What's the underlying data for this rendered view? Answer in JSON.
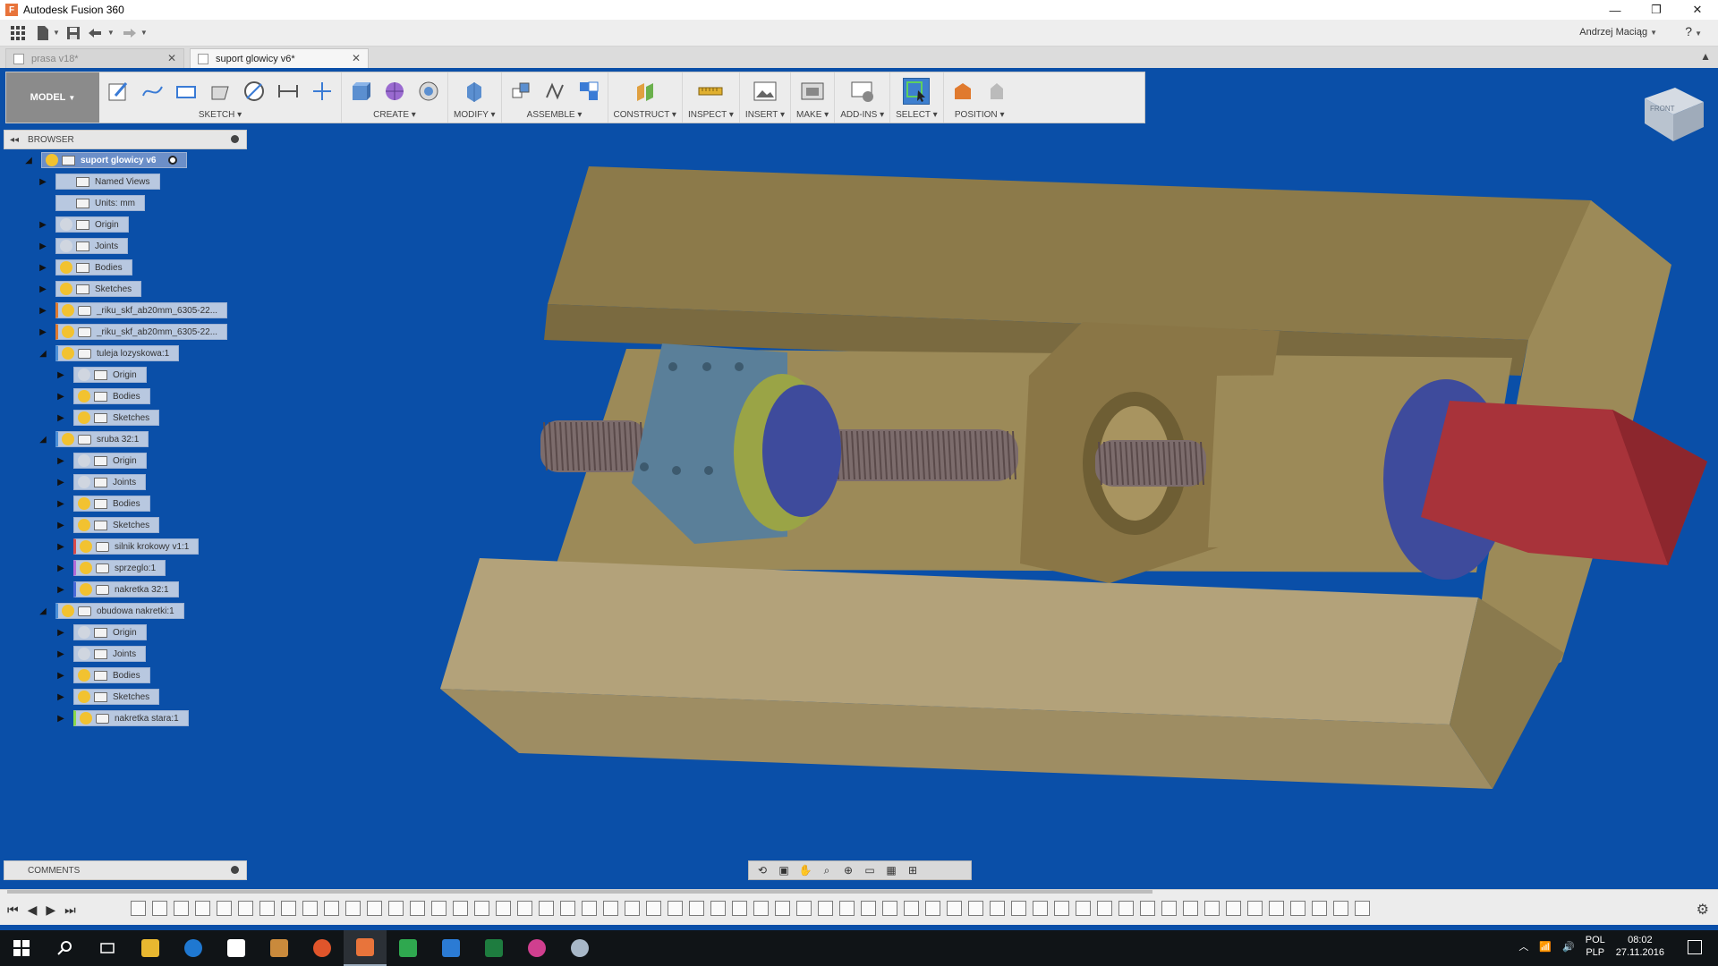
{
  "window": {
    "title": "Autodesk Fusion 360",
    "app_icon": "F",
    "controls": [
      "—",
      "❐",
      "✕"
    ]
  },
  "quick_access": {
    "user": "Andrzej Maciąg",
    "help_icon": "?"
  },
  "tabs": [
    {
      "label": "prasa v18*",
      "active": false
    },
    {
      "label": "suport glowicy v6*",
      "active": true
    }
  ],
  "toolbar": {
    "mode": "MODEL",
    "groups": [
      {
        "label": "SKETCH",
        "icons": [
          "create-sketch-icon",
          "spline-icon",
          "rectangle-icon",
          "extrude-sketch-icon",
          "circle-icon",
          "dimension-icon",
          "construction-line-icon"
        ]
      },
      {
        "label": "CREATE",
        "icons": [
          "box-icon",
          "form-icon",
          "revolve-icon"
        ]
      },
      {
        "label": "MODIFY",
        "icons": [
          "press-pull-icon"
        ]
      },
      {
        "label": "ASSEMBLE",
        "icons": [
          "new-component-icon",
          "joint-icon",
          "as-built-joint-icon"
        ]
      },
      {
        "label": "CONSTRUCT",
        "icons": [
          "offset-plane-icon"
        ]
      },
      {
        "label": "INSPECT",
        "icons": [
          "measure-icon"
        ]
      },
      {
        "label": "INSERT",
        "icons": [
          "insert-image-icon"
        ]
      },
      {
        "label": "MAKE",
        "icons": [
          "3d-print-icon"
        ]
      },
      {
        "label": "ADD-INS",
        "icons": [
          "scripts-icon"
        ]
      },
      {
        "label": "SELECT",
        "icons": [
          "select-icon"
        ]
      },
      {
        "label": "POSITION",
        "icons": [
          "capture-position-icon",
          "revert-icon"
        ]
      }
    ]
  },
  "viewcube": {
    "face": "FRONT"
  },
  "browser": {
    "title": "BROWSER",
    "nodes": [
      {
        "label": "suport glowicy v6",
        "level": 0,
        "expander": "open",
        "bulb": "#f2c230",
        "root": true
      },
      {
        "label": "Named Views",
        "level": 1,
        "expander": "closed",
        "bulb": "none"
      },
      {
        "label": "Units: mm",
        "level": 1,
        "expander": "none",
        "bulb": "none"
      },
      {
        "label": "Origin",
        "level": 1,
        "expander": "closed",
        "bulb": "#d0d6e0"
      },
      {
        "label": "Joints",
        "level": 1,
        "expander": "closed",
        "bulb": "#d0d6e0"
      },
      {
        "label": "Bodies",
        "level": 1,
        "expander": "closed",
        "bulb": "#f2c230"
      },
      {
        "label": "Sketches",
        "level": 1,
        "expander": "closed",
        "bulb": "#f2c230"
      },
      {
        "label": "_riku_skf_ab20mm_6305-22...",
        "level": 1,
        "expander": "closed",
        "bulb": "#f2c230",
        "component": true,
        "marker": "#e07a2e"
      },
      {
        "label": "_riku_skf_ab20mm_6305-22...",
        "level": 1,
        "expander": "closed",
        "bulb": "#f2c230",
        "component": true,
        "marker": "#e07a2e"
      },
      {
        "label": "tuleja lozyskowa:1",
        "level": 1,
        "expander": "open",
        "bulb": "#f2c230",
        "component": true,
        "marker": "#4a8fd8"
      },
      {
        "label": "Origin",
        "level": 2,
        "expander": "closed",
        "bulb": "#d0d6e0"
      },
      {
        "label": "Bodies",
        "level": 2,
        "expander": "closed",
        "bulb": "#f2c230"
      },
      {
        "label": "Sketches",
        "level": 2,
        "expander": "closed",
        "bulb": "#f2c230"
      },
      {
        "label": "sruba 32:1",
        "level": 1,
        "expander": "open",
        "bulb": "#f2c230",
        "component": true,
        "marker": "#4a8fd8"
      },
      {
        "label": "Origin",
        "level": 2,
        "expander": "closed",
        "bulb": "#d0d6e0"
      },
      {
        "label": "Joints",
        "level": 2,
        "expander": "closed",
        "bulb": "#d0d6e0"
      },
      {
        "label": "Bodies",
        "level": 2,
        "expander": "closed",
        "bulb": "#f2c230"
      },
      {
        "label": "Sketches",
        "level": 2,
        "expander": "closed",
        "bulb": "#f2c230"
      },
      {
        "label": "silnik krokowy v1:1",
        "level": 2,
        "expander": "closed",
        "bulb": "#f2c230",
        "component": true,
        "marker": "#d84a4a"
      },
      {
        "label": "sprzeglo:1",
        "level": 2,
        "expander": "closed",
        "bulb": "#f2c230",
        "component": true,
        "marker": "#b36ad8"
      },
      {
        "label": "nakretka 32:1",
        "level": 2,
        "expander": "closed",
        "bulb": "#f2c230",
        "component": true,
        "marker": "#4a6ad8"
      },
      {
        "label": "obudowa nakretki:1",
        "level": 1,
        "expander": "open",
        "bulb": "#f2c230",
        "component": true,
        "marker": "#4a8fd8"
      },
      {
        "label": "Origin",
        "level": 2,
        "expander": "closed",
        "bulb": "#d0d6e0"
      },
      {
        "label": "Joints",
        "level": 2,
        "expander": "closed",
        "bulb": "#d0d6e0"
      },
      {
        "label": "Bodies",
        "level": 2,
        "expander": "closed",
        "bulb": "#f2c230"
      },
      {
        "label": "Sketches",
        "level": 2,
        "expander": "closed",
        "bulb": "#f2c230"
      },
      {
        "label": "nakretka stara:1",
        "level": 2,
        "expander": "closed",
        "bulb": "#f2c230",
        "component": true,
        "marker": "#8ad84a"
      }
    ]
  },
  "comments": {
    "title": "COMMENTS"
  },
  "viewport": {
    "background": "#0a4fa8",
    "colors": {
      "base_top": "#8c7a4a",
      "base_front": "#b3a27a",
      "base_side": "#9c8a58",
      "housing": "#5a7f99",
      "flange": "#3e4b9c",
      "ring": "#9aa446",
      "motor": "#a8333a",
      "screw": "#7c6c6c"
    }
  },
  "timeline": {
    "settings_icon": "gear-icon"
  },
  "taskbar": {
    "apps": [
      "start-icon",
      "search-icon",
      "task-view-icon",
      "file-explorer-icon",
      "edge-icon",
      "store-icon",
      "media-icon",
      "firefox-icon",
      "fusion360-icon",
      "camtasia-icon",
      "onenote-icon",
      "excel-icon",
      "itunes-icon",
      "paint-icon"
    ],
    "lang_top": "POL",
    "lang_bottom": "PLP",
    "time": "08:02",
    "date": "27.11.2016"
  }
}
